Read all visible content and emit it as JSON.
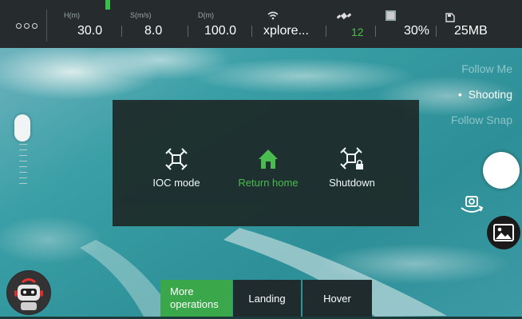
{
  "topbar": {
    "height_label": "H(m)",
    "height_value": "30.0",
    "speed_label": "S(m/s)",
    "speed_value": "8.0",
    "distance_label": "D(m)",
    "distance_value": "100.0",
    "wifi_name": "xplore...",
    "gps_count": "12",
    "battery": "30%",
    "storage": "25MB"
  },
  "modes": {
    "items": [
      {
        "label": "Follow Me",
        "state": "dim"
      },
      {
        "label": "Shooting",
        "state": "active"
      },
      {
        "label": "Follow Snap",
        "state": "dim"
      }
    ]
  },
  "popup": {
    "ioc_label": "IOC mode",
    "return_label": "Return home",
    "shutdown_label": "Shutdown"
  },
  "bottom": {
    "more_line1": "More",
    "more_line2": "operations",
    "landing_label": "Landing",
    "hover_label": "Hover"
  },
  "colors": {
    "accent_green": "#4cbf4a",
    "bar_background": "#262b2d"
  },
  "icons": [
    "menu-icon",
    "wifi-icon",
    "satellite-icon",
    "battery-icon",
    "sd-card-icon",
    "drone-icon",
    "home-icon",
    "drone-lock-icon",
    "camera-switch-icon",
    "gallery-icon",
    "robot-icon"
  ]
}
